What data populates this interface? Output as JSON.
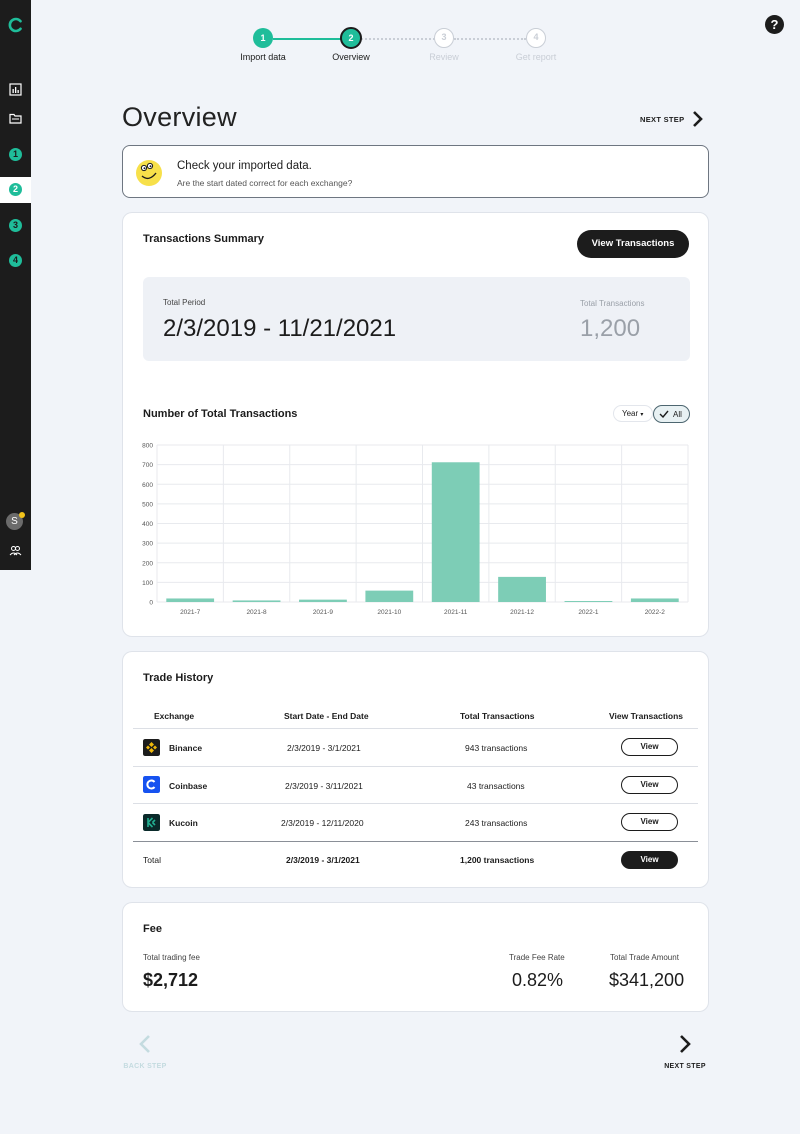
{
  "sidebar": {
    "steps": [
      "1",
      "2",
      "3",
      "4"
    ],
    "avatar_initial": "S"
  },
  "help_icon": "?",
  "stepper": {
    "steps": [
      {
        "num": "1",
        "label": "Import data",
        "state": "done"
      },
      {
        "num": "2",
        "label": "Overview",
        "state": "active"
      },
      {
        "num": "3",
        "label": "Review",
        "state": "pending"
      },
      {
        "num": "4",
        "label": "Get report",
        "state": "pending"
      }
    ]
  },
  "header": {
    "title": "Overview",
    "next_label": "NEXT STEP"
  },
  "banner": {
    "title": "Check your imported data.",
    "subtitle": "Are the start dated correct for each exchange?"
  },
  "summary": {
    "title": "Transactions Summary",
    "view_button": "View Transactions",
    "period_label": "Total Period",
    "period_value": "2/3/2019 - 11/21/2021",
    "total_label": "Total Transactions",
    "total_value": "1,200",
    "chart_title": "Number of Total Transactions",
    "year_filter": "Year",
    "all_filter": "All"
  },
  "chart_data": {
    "type": "bar",
    "categories": [
      "2021-7",
      "2021-8",
      "2021-9",
      "2021-10",
      "2021-11",
      "2021-12",
      "2022-1",
      "2022-2"
    ],
    "values": [
      18,
      8,
      12,
      58,
      712,
      128,
      5,
      18
    ],
    "ylim": [
      0,
      800
    ],
    "yticks": [
      0,
      100,
      200,
      300,
      400,
      500,
      600,
      700,
      800
    ],
    "color": "#7dcdb6",
    "grid": true
  },
  "trade_history": {
    "title": "Trade History",
    "headers": [
      "Exchange",
      "Start Date - End Date",
      "Total Transactions",
      "View Transactions"
    ],
    "rows": [
      {
        "exchange": "Binance",
        "dates": "2/3/2019 - 3/1/2021",
        "transactions": "943 transactions",
        "action": "View",
        "icon": "binance-icon",
        "color": "#1c1c1c"
      },
      {
        "exchange": "Coinbase",
        "dates": "2/3/2019 - 3/11/2021",
        "transactions": "43 transactions",
        "action": "View",
        "icon": "coinbase-icon",
        "color": "#1652f0"
      },
      {
        "exchange": "Kucoin",
        "dates": "2/3/2019 - 12/11/2020",
        "transactions": "243 transactions",
        "action": "View",
        "icon": "kucoin-icon",
        "color": "#0a2a2a"
      }
    ],
    "total": {
      "label": "Total",
      "dates": "2/3/2019 - 3/1/2021",
      "transactions": "1,200 transactions",
      "action": "View"
    }
  },
  "fee": {
    "title": "Fee",
    "trading_fee_label": "Total trading fee",
    "trading_fee_value": "$2,712",
    "rate_label": "Trade Fee Rate",
    "rate_value": "0.82%",
    "amount_label": "Total Trade Amount",
    "amount_value": "$341,200"
  },
  "footer_nav": {
    "back_label": "BACK STEP",
    "next_label": "NEXT STEP"
  },
  "colors": {
    "accent": "#1fbd9a",
    "dark": "#1c1c1c",
    "bar": "#7dcdb6"
  }
}
